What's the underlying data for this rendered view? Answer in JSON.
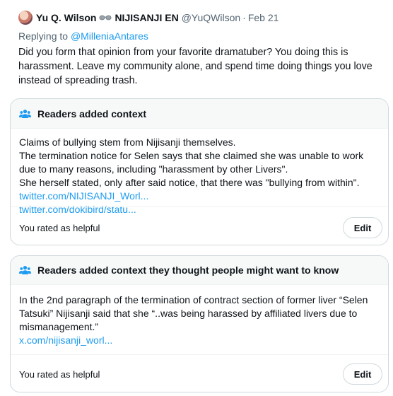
{
  "tweet": {
    "author_name": "Yu Q. Wilson",
    "affiliation": "NIJISANJI EN",
    "handle": "@YuQWilson",
    "separator": "·",
    "date": "Feb 21",
    "replying_prefix": "Replying to ",
    "replying_to": "@MilleniaAntares",
    "text": "Did you form that opinion from your favorite dramatuber? You doing this is harassment. Leave my community alone, and spend time doing things you love instead of spreading trash."
  },
  "notes": [
    {
      "title": "Readers added context",
      "paragraphs": [
        "Claims of bullying stem from Nijisanji themselves.",
        "The termination notice for Selen says that she claimed she was unable to work due to many reasons, including \"harassment by other Livers\".",
        "She herself stated, only after said notice, that there was \"bullying from within\"."
      ],
      "links": [
        "twitter.com/NIJISANJI_Worl...",
        "twitter.com/dokibird/statu..."
      ],
      "rating_text": "You rated as helpful",
      "edit_label": "Edit"
    },
    {
      "title": "Readers added context they thought people might want to know",
      "paragraphs": [
        "In the 2nd paragraph of the termination of contract section of former liver “Selen Tatsuki” Nijisanji said that she “..was being harassed by affiliated livers due to mismanagement.”"
      ],
      "links": [
        "x.com/nijisanji_worl..."
      ],
      "rating_text": "You rated as helpful",
      "edit_label": "Edit"
    }
  ],
  "colors": {
    "link": "#1d9bf0",
    "secondary_text": "#536471",
    "icon_blue": "#1d9bf0",
    "border": "#cfd9de"
  },
  "icons": {
    "avatar": "user-avatar",
    "affiliation_badge": "glasses-icon",
    "note_header": "people-group-icon"
  }
}
